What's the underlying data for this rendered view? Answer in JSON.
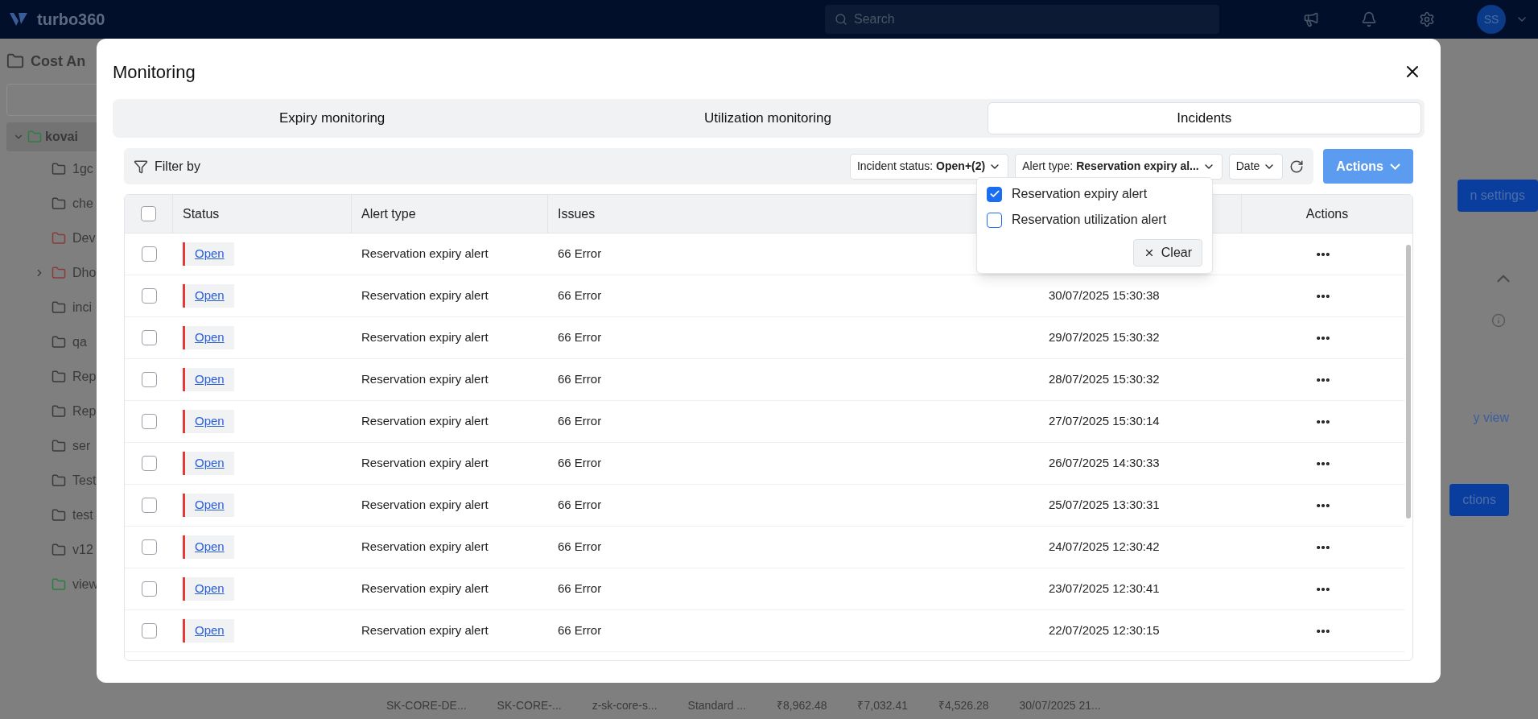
{
  "app_bar": {
    "logo": "turbo360",
    "search": {
      "placeholder": "Search"
    },
    "avatar": "SS"
  },
  "sidebar": {
    "title": "Cost An",
    "items": [
      {
        "label": "kovai",
        "expanded": true,
        "selected": true,
        "color": "#2e7d46",
        "children": [
          {
            "label": "1gc",
            "color": "#3a3a3a",
            "expandable": false
          },
          {
            "label": "che",
            "color": "#3a3a3a",
            "expandable": false
          },
          {
            "label": "Dev",
            "color": "#8a3b3b",
            "expandable": false
          },
          {
            "label": "Dho",
            "color": "#8a3b3b",
            "expandable": true
          },
          {
            "label": "inci",
            "color": "#3a3a3a",
            "expandable": false
          },
          {
            "label": "qa",
            "color": "#3a3a3a",
            "expandable": false
          },
          {
            "label": "Rep",
            "color": "#3a3a3a",
            "expandable": false
          },
          {
            "label": "Rep",
            "color": "#3a3a3a",
            "expandable": false
          },
          {
            "label": "ser",
            "color": "#3a3a3a",
            "expandable": false
          },
          {
            "label": "Test",
            "color": "#3a3a3a",
            "expandable": false
          },
          {
            "label": "test",
            "color": "#3a3a3a",
            "expandable": false
          },
          {
            "label": "v12",
            "color": "#3a3a3a",
            "expandable": false
          },
          {
            "label": "view",
            "color": "#2e7d46",
            "expandable": false
          }
        ]
      }
    ]
  },
  "background_right": {
    "settings_button": "n settings",
    "link": "y view",
    "actions_button": "ctions"
  },
  "background_row": {
    "cells": [
      "SK-CORE-DE...",
      "SK-CORE-...",
      "z-sk-core-s...",
      "Standard ...",
      "₹8,962.48",
      "₹7,032.41",
      "₹4,526.28",
      "30/07/2025 21..."
    ]
  },
  "dialog": {
    "title": "Monitoring",
    "tabs": [
      {
        "label": "Expiry monitoring",
        "selected": false
      },
      {
        "label": "Utilization monitoring",
        "selected": false
      },
      {
        "label": "Incidents",
        "selected": true
      }
    ],
    "filter_label": "Filter by",
    "filters": [
      {
        "label": "Incident status:",
        "value": "Open+(2)"
      },
      {
        "label": "Alert type:",
        "value": "Reservation expiry al..."
      },
      {
        "label": "Date"
      }
    ],
    "actions_button": "Actions",
    "dropdown": {
      "options": [
        {
          "label": "Reservation expiry alert",
          "checked": true
        },
        {
          "label": "Reservation utilization alert",
          "checked": false
        }
      ],
      "clear": "Clear"
    },
    "table": {
      "select_all_checked": false,
      "columns": [
        "Status",
        "Alert type",
        "Issues",
        "",
        "Actions"
      ],
      "rows": [
        {
          "status": "Open",
          "alert_type": "Reservation expiry alert",
          "issues": "66 Error",
          "date": "",
          "checked": false
        },
        {
          "status": "Open",
          "alert_type": "Reservation expiry alert",
          "issues": "66 Error",
          "date": "30/07/2025 15:30:38",
          "checked": false
        },
        {
          "status": "Open",
          "alert_type": "Reservation expiry alert",
          "issues": "66 Error",
          "date": "29/07/2025 15:30:32",
          "checked": false
        },
        {
          "status": "Open",
          "alert_type": "Reservation expiry alert",
          "issues": "66 Error",
          "date": "28/07/2025 15:30:32",
          "checked": false
        },
        {
          "status": "Open",
          "alert_type": "Reservation expiry alert",
          "issues": "66 Error",
          "date": "27/07/2025 15:30:14",
          "checked": false
        },
        {
          "status": "Open",
          "alert_type": "Reservation expiry alert",
          "issues": "66 Error",
          "date": "26/07/2025 14:30:33",
          "checked": false
        },
        {
          "status": "Open",
          "alert_type": "Reservation expiry alert",
          "issues": "66 Error",
          "date": "25/07/2025 13:30:31",
          "checked": false
        },
        {
          "status": "Open",
          "alert_type": "Reservation expiry alert",
          "issues": "66 Error",
          "date": "24/07/2025 12:30:42",
          "checked": false
        },
        {
          "status": "Open",
          "alert_type": "Reservation expiry alert",
          "issues": "66 Error",
          "date": "23/07/2025 12:30:41",
          "checked": false
        },
        {
          "status": "Open",
          "alert_type": "Reservation expiry alert",
          "issues": "66 Error",
          "date": "22/07/2025 12:30:15",
          "checked": false
        }
      ]
    }
  }
}
